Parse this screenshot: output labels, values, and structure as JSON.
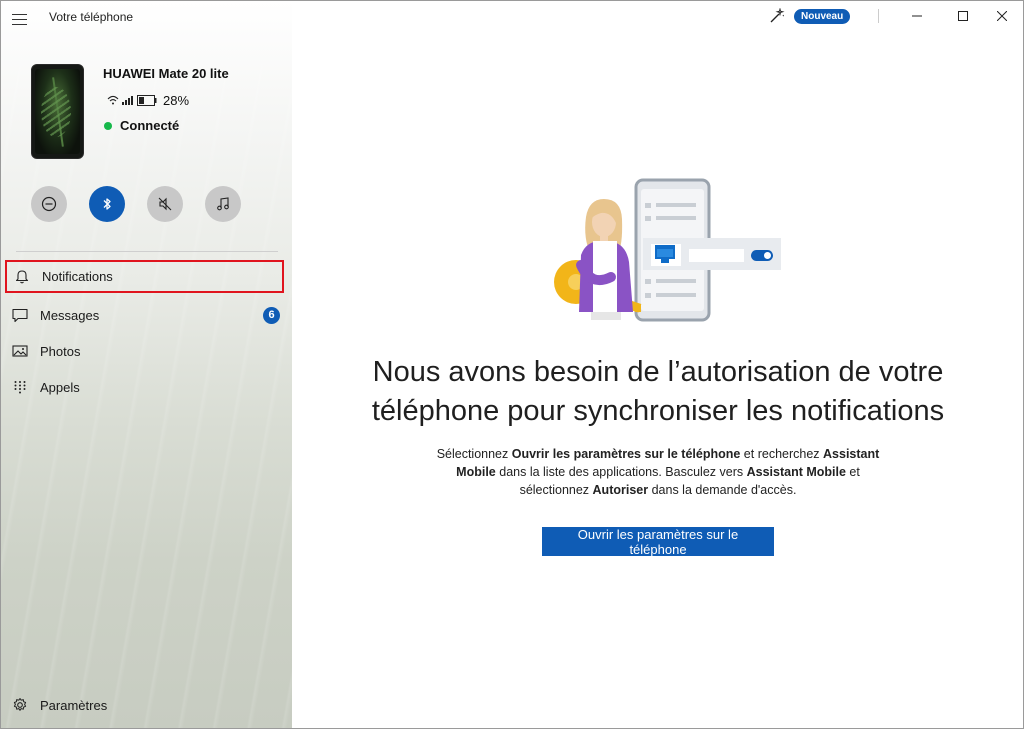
{
  "app": {
    "title": "Votre téléphone"
  },
  "device": {
    "name": "HUAWEI Mate 20 lite",
    "battery": "28%",
    "connection": "Connecté"
  },
  "quick_actions": [
    {
      "icon": "do-not-disturb-icon",
      "active": false
    },
    {
      "icon": "bluetooth-icon",
      "active": true
    },
    {
      "icon": "mute-icon",
      "active": false
    },
    {
      "icon": "music-icon",
      "active": false
    }
  ],
  "nav": {
    "notifications": "Notifications",
    "messages": "Messages",
    "messages_badge": "6",
    "photos": "Photos",
    "calls": "Appels",
    "settings": "Paramètres"
  },
  "titlebar": {
    "new_badge": "Nouveau"
  },
  "main": {
    "heading_line1": "Nous avons besoin de l’autorisation de votre",
    "heading_line2": "téléphone pour synchroniser les notifications",
    "desc": {
      "p1": "Sélectionnez ",
      "b1": "Ouvrir les paramètres sur le téléphone",
      "p2": " et recherchez ",
      "b2": "Assistant Mobile",
      "p3": " dans la liste des applications. Basculez vers ",
      "b3": "Assistant Mobile",
      "p4": " et sélectionnez ",
      "b4": "Autoriser",
      "p5": " dans la demande d'accès."
    },
    "button": "Ouvrir les paramètres sur le téléphone"
  },
  "colors": {
    "accent": "#0f5cb5",
    "highlight_box": "#e0141e",
    "connected": "#16b84a"
  }
}
